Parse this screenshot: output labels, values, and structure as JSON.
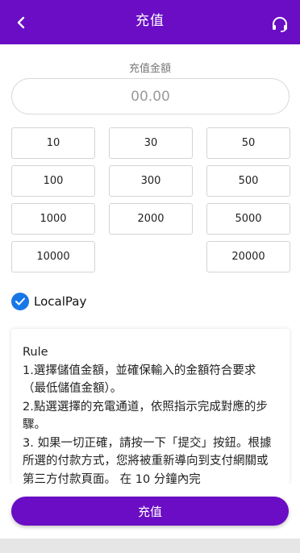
{
  "header": {
    "title": "充值",
    "back_icon": "chevron-left-icon",
    "support_icon": "headset-icon",
    "color": "#6a0dc4"
  },
  "amount": {
    "label": "充值金額",
    "placeholder": "00.00",
    "value": ""
  },
  "presets": [
    {
      "label": "10"
    },
    {
      "label": "30"
    },
    {
      "label": "50"
    },
    {
      "label": "100"
    },
    {
      "label": "300"
    },
    {
      "label": "500"
    },
    {
      "label": "1000"
    },
    {
      "label": "2000"
    },
    {
      "label": "5000"
    },
    {
      "label": "10000"
    },
    {
      "label": "20000"
    }
  ],
  "payment": {
    "option_label": "LocalPay",
    "selected": true,
    "check_color": "#1877e6"
  },
  "rules": {
    "title": "Rule",
    "text": "1.選擇儲值金額，並確保輸入的金額符合要求（最低儲值金額）。\n2.點選選擇的充電通道，依照指示完成對應的步驟。\n3. 如果一切正確，請按一下「提交」按鈕。根據所選的付款方式，您將被重新導向到支付網關或第三方付款頁面。 在 10 分鐘內完"
  },
  "submit": {
    "label": "充值"
  }
}
